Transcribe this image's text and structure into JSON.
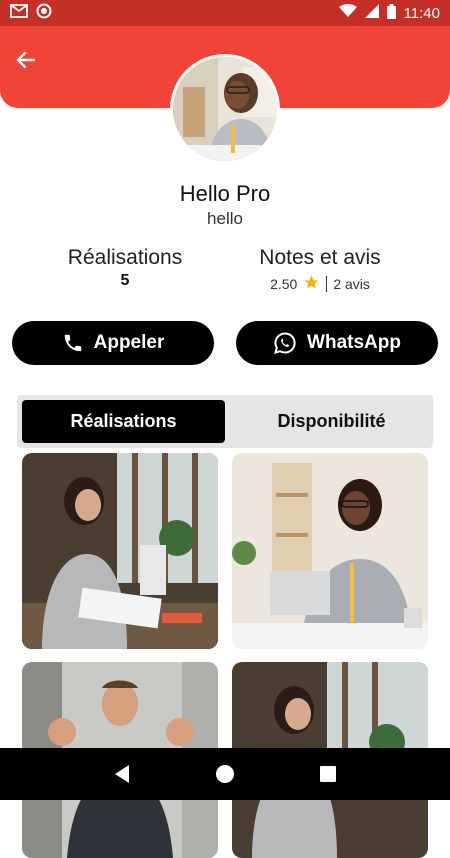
{
  "status_bar": {
    "time": "11:40",
    "icons": [
      "gmail-icon",
      "record-icon",
      "wifi-icon",
      "signal-icon",
      "battery-icon"
    ]
  },
  "header": {
    "accent": "#f14437",
    "back_icon": "arrow-left-icon"
  },
  "profile": {
    "name": "Hello Pro",
    "subtitle": "hello"
  },
  "stats": {
    "realisations": {
      "label": "Réalisations",
      "value": "5"
    },
    "reviews": {
      "label": "Notes et avis",
      "rating": "2.50",
      "count": "2 avis",
      "star_color": "#f5b400"
    }
  },
  "actions": {
    "call": {
      "label": "Appeler",
      "icon": "phone-icon"
    },
    "whatsapp": {
      "label": "WhatsApp",
      "icon": "whatsapp-icon"
    }
  },
  "tabs": [
    {
      "label": "Réalisations",
      "active": true
    },
    {
      "label": "Disponibilité",
      "active": false
    }
  ],
  "gallery": [
    {
      "name": "woman-on-phone-at-desk-photo"
    },
    {
      "name": "smiling-woman-at-laptop-photo"
    },
    {
      "name": "excited-man-fists-photo"
    },
    {
      "name": "woman-on-phone-at-desk-photo-2"
    }
  ],
  "nav_bar": {
    "buttons": [
      "back-triangle-icon",
      "home-circle-icon",
      "recents-square-icon"
    ]
  }
}
